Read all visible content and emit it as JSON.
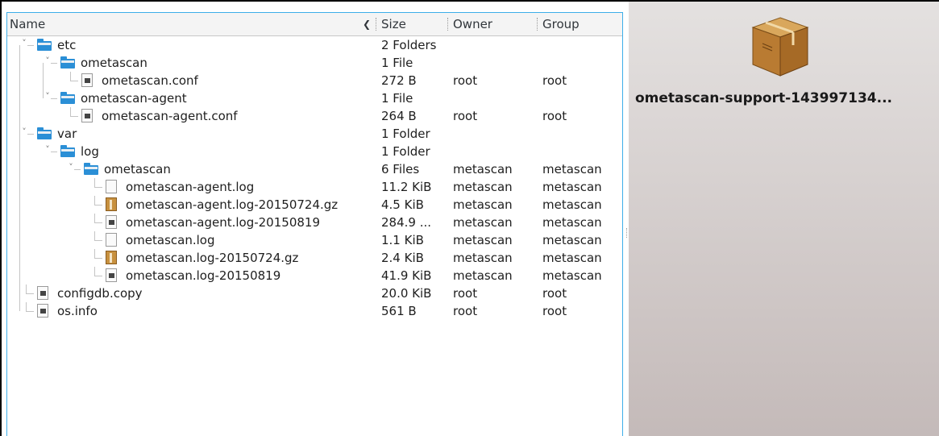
{
  "columns": {
    "name": "Name",
    "size": "Size",
    "owner": "Owner",
    "group": "Group"
  },
  "rows": [
    {
      "name": "etc",
      "size": "2 Folders",
      "owner": "",
      "group": "",
      "type": "folder",
      "expanded": true
    },
    {
      "name": "ometascan",
      "size": "1 File",
      "owner": "",
      "group": "",
      "type": "folder",
      "expanded": true
    },
    {
      "name": "ometascan.conf",
      "size": "272 B",
      "owner": "root",
      "group": "root",
      "type": "text-file"
    },
    {
      "name": "ometascan-agent",
      "size": "1 File",
      "owner": "",
      "group": "",
      "type": "folder",
      "expanded": true
    },
    {
      "name": "ometascan-agent.conf",
      "size": "264 B",
      "owner": "root",
      "group": "root",
      "type": "text-file"
    },
    {
      "name": "var",
      "size": "1 Folder",
      "owner": "",
      "group": "",
      "type": "folder",
      "expanded": true
    },
    {
      "name": "log",
      "size": "1 Folder",
      "owner": "",
      "group": "",
      "type": "folder",
      "expanded": true
    },
    {
      "name": "ometascan",
      "size": "6 Files",
      "owner": "metascan",
      "group": "metascan",
      "type": "folder",
      "expanded": true
    },
    {
      "name": "ometascan-agent.log",
      "size": "11.2 KiB",
      "owner": "metascan",
      "group": "metascan",
      "type": "log-file"
    },
    {
      "name": "ometascan-agent.log-20150724.gz",
      "size": "4.5 KiB",
      "owner": "metascan",
      "group": "metascan",
      "type": "gz-archive"
    },
    {
      "name": "ometascan-agent.log-20150819",
      "size": "284.9 ...",
      "owner": "metascan",
      "group": "metascan",
      "type": "text-file"
    },
    {
      "name": "ometascan.log",
      "size": "1.1 KiB",
      "owner": "metascan",
      "group": "metascan",
      "type": "log-file"
    },
    {
      "name": "ometascan.log-20150724.gz",
      "size": "2.4 KiB",
      "owner": "metascan",
      "group": "metascan",
      "type": "gz-archive"
    },
    {
      "name": "ometascan.log-20150819",
      "size": "41.9 KiB",
      "owner": "metascan",
      "group": "metascan",
      "type": "text-file"
    },
    {
      "name": "configdb.copy",
      "size": "20.0 KiB",
      "owner": "root",
      "group": "root",
      "type": "text-file"
    },
    {
      "name": "os.info",
      "size": "561 B",
      "owner": "root",
      "group": "root",
      "type": "text-file"
    }
  ],
  "preview": {
    "archive_name": "ometascan-support-143997134...",
    "icon": "package-box-icon"
  },
  "colors": {
    "accent": "#3daee9",
    "folder": "#2b8fd6",
    "archive": "#c8913f"
  }
}
